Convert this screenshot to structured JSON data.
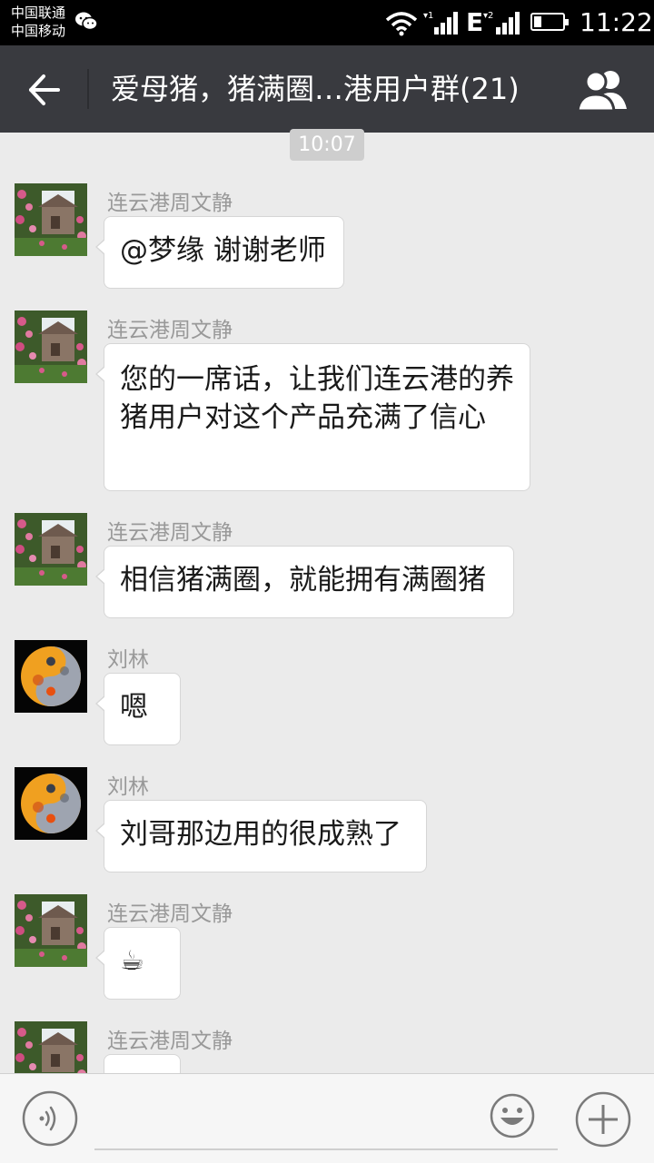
{
  "status_bar": {
    "carrier1": "中国联通",
    "carrier2": "中国移动",
    "network_type": "E",
    "time": "11:22"
  },
  "header": {
    "title": "爱母猪，猪满圈…港用户群(21)",
    "back_icon": "arrow-left-icon",
    "group_icon": "group-members-icon"
  },
  "chat": {
    "timestamp": "10:07",
    "messages": [
      {
        "sender": "连云港周文静",
        "text": "@梦缘 谢谢老师"
      },
      {
        "sender": "连云港周文静",
        "text": "您的一席话，让我们连云港的养猪用户对这个产品充满了信心"
      },
      {
        "sender": "连云港周文静",
        "text": "相信猪满圈，就能拥有满圈猪"
      },
      {
        "sender": "刘林",
        "text": "嗯"
      },
      {
        "sender": "刘林",
        "text": "刘哥那边用的很成熟了"
      },
      {
        "sender": "连云港周文静",
        "text": "☕"
      },
      {
        "sender": "连云港周文静",
        "text": ""
      }
    ]
  },
  "input_bar": {
    "voice_icon": "voice-icon",
    "emoji_icon": "emoji-icon",
    "plus_icon": "plus-icon",
    "text_value": ""
  },
  "colors": {
    "status_bar": "#000000",
    "title_bar": "#393a3f",
    "chat_bg": "#ebebeb",
    "bubble": "#ffffff"
  }
}
